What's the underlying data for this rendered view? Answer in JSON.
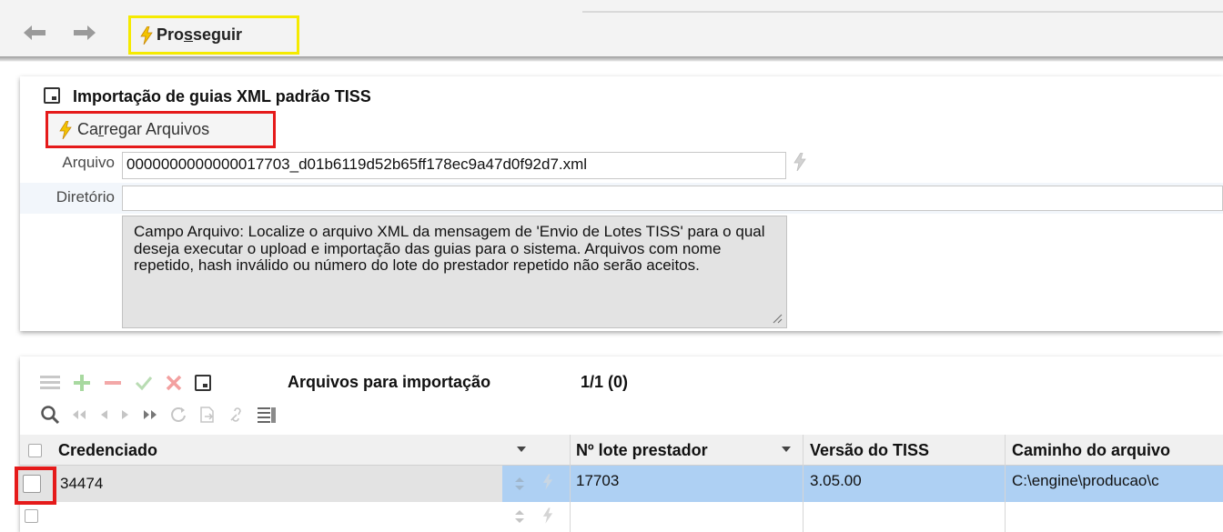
{
  "toolbar": {
    "back_icon": "arrow-left-icon",
    "forward_icon": "arrow-right-icon",
    "prosseguir_prefix": "Pro",
    "prosseguir_underlined": "s",
    "prosseguir_suffix": "seguir",
    "highlight_color": "#f5ea00"
  },
  "import_panel": {
    "title": "Importação de guias XML padrão TISS",
    "carregar_prefix": "Ca",
    "carregar_underlined": "r",
    "carregar_suffix": "regar Arquivos",
    "arquivo_label": "Arquivo",
    "arquivo_value": "0000000000000017703_d01b6119d52b65ff178ec9a47d0f92d7.xml",
    "diretorio_label": "Diretório",
    "diretorio_value": "",
    "help_text": "Campo Arquivo: Localize o arquivo XML da mensagem de 'Envio de Lotes TISS' para o qual deseja executar o upload e importação das guias para o sistema. Arquivos com nome repetido, hash inválido ou número do lote do prestador repetido não serão aceitos.",
    "highlight_color": "#e51a1a"
  },
  "files_panel": {
    "title": "Arquivos para importação",
    "counter": "1/1 (0)",
    "columns": [
      "Credenciado",
      "Nº lote prestador",
      "Versão do TISS",
      "Caminho do arquivo"
    ],
    "rows": [
      {
        "credenciado": "34474",
        "lote": "17703",
        "versao": "3.05.00",
        "caminho": "C:\\engine\\producao\\c"
      }
    ],
    "selected_row_color": "#aed0f3"
  }
}
